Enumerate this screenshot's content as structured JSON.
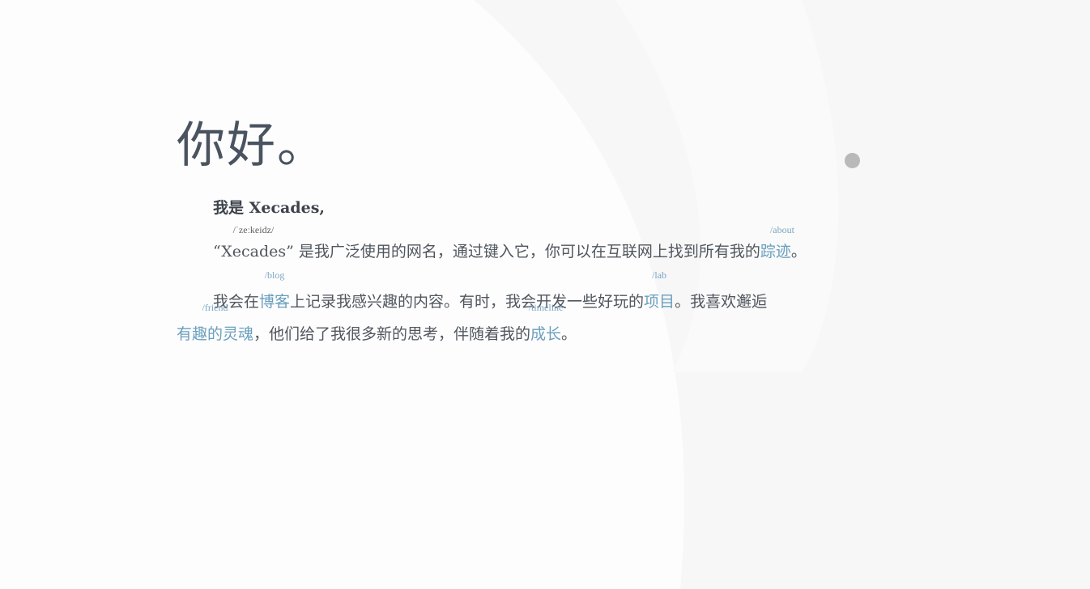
{
  "hero": {
    "title": "你好。"
  },
  "intro": {
    "greeting": "我是 Xecades,",
    "name_quoted": "“Xecades”",
    "name_pronunciation": "/ˈzeːkeidz/",
    "p1_text": " 是我广泛使用的网名，通过键入它，你可以在互联网上找到所有我的",
    "p1_link": "踪迹",
    "p1_link_hint": "/about",
    "p1_end": "。",
    "p2_a": "我会在",
    "p2_link_blog": "博客",
    "p2_link_blog_hint": "/blog",
    "p2_b": "上记录我感兴趣的内容。有时，我会开发一些好玩的",
    "p2_link_lab": "项目",
    "p2_link_lab_hint": "/lab",
    "p2_c": "。我喜欢邂逅",
    "p2_link_friend": "有趣的灵魂",
    "p2_link_friend_hint": "/friend",
    "p2_d": "，他们给了我很多新的思考，伴随着我的",
    "p2_link_timeline": "成长",
    "p2_link_timeline_hint": "/timeline",
    "p2_end": "。"
  },
  "colors": {
    "link": "#6a9fbe",
    "text": "#50565e",
    "background": "#fdfdfd",
    "dot": "#b9b9b9"
  }
}
